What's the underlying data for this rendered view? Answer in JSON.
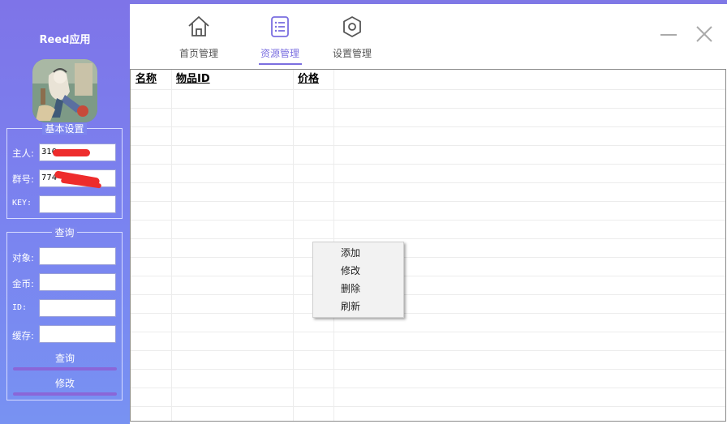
{
  "app": {
    "title": "Reed应用"
  },
  "sidebar": {
    "basic_settings": {
      "title": "基本设置",
      "fields": [
        {
          "label": "主人:",
          "value": "310"
        },
        {
          "label": "群号:",
          "value": "774"
        },
        {
          "label": "KEY:",
          "value": ""
        }
      ]
    },
    "query": {
      "title": "查询",
      "fields": [
        {
          "label": "对象:",
          "value": ""
        },
        {
          "label": "金币:",
          "value": ""
        },
        {
          "label": "ID:",
          "value": ""
        },
        {
          "label": "缓存:",
          "value": ""
        }
      ],
      "query_button": "查询",
      "modify_button": "修改"
    }
  },
  "nav": {
    "tabs": [
      {
        "label": "首页管理",
        "icon": "home-icon"
      },
      {
        "label": "资源管理",
        "icon": "list-icon",
        "active": true
      },
      {
        "label": "设置管理",
        "icon": "gear-icon"
      }
    ]
  },
  "table": {
    "columns": [
      "名称",
      "物品ID",
      "价格"
    ],
    "rows": []
  },
  "context_menu": {
    "items": [
      "添加",
      "修改",
      "删除",
      "刷新"
    ]
  },
  "colors": {
    "accent": "#7b6fe0",
    "sidebar": "#7a80ee",
    "scribble": "#ee2c2c"
  }
}
